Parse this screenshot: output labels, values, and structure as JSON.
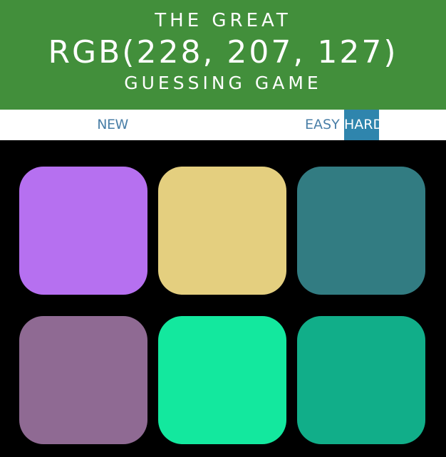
{
  "header": {
    "title_top": "THE GREAT",
    "target_color": "RGB(228, 207, 127)",
    "title_bottom": "GUESSING GAME",
    "background": "#428f3b"
  },
  "stripe": {
    "new_colors_label": "NEW COLORS",
    "easy_label": "EASY",
    "hard_label": "HARD",
    "selected_mode": "HARD",
    "accent": "#2f85ad",
    "text_color": "#4a7fa7"
  },
  "board": {
    "background": "#000000",
    "squares": [
      {
        "color": "#b670f0"
      },
      {
        "color": "#e4cf7f"
      },
      {
        "color": "#327c82"
      },
      {
        "color": "#8f6a93"
      },
      {
        "color": "#13e89e"
      },
      {
        "color": "#11ae89"
      }
    ]
  }
}
